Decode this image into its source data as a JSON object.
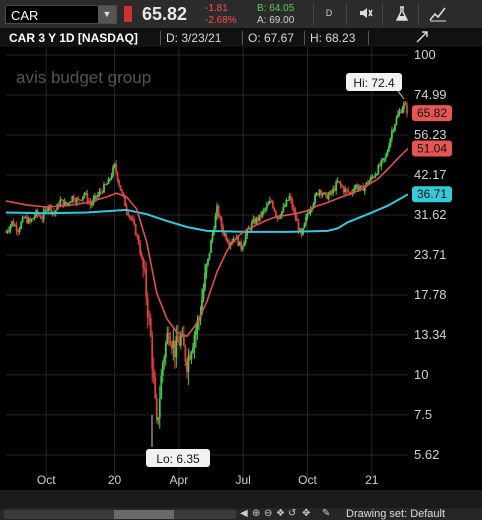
{
  "toolbar": {
    "symbol": "CAR",
    "last": "65.82",
    "change": "-1.81",
    "change_pct": "-2.68%",
    "bid": "B: 64.05",
    "ask": "A: 69.00",
    "d_label": "D",
    "icons": [
      "dropdown-icon",
      "flag-icon",
      "speaker-icon",
      "flask-icon",
      "draw-icon"
    ]
  },
  "header": {
    "title": "CAR 3 Y 1D [NASDAQ]",
    "date": "D: 3/23/21",
    "open": "O: 67.67",
    "high": "H: 68.23",
    "icon": "expand-icon"
  },
  "chart_data": {
    "type": "candlestick",
    "watermark": "avis budget group",
    "y_scale": "log",
    "y_ticks": [
      "100",
      "74.99",
      "56.23",
      "42.17",
      "31.62",
      "23.71",
      "17.78",
      "13.34",
      "10",
      "7.5",
      "5.62"
    ],
    "x_ticks": [
      "Oct",
      "20",
      "Apr",
      "Jul",
      "Oct",
      "21"
    ],
    "price_labels": [
      {
        "text": "65.82",
        "value": 65.82,
        "color": "#e85555"
      },
      {
        "text": "51.04",
        "value": 51.04,
        "color": "#e85555"
      },
      {
        "text": "36.71",
        "value": 36.71,
        "color": "#36c9d9"
      }
    ],
    "hi_label": "Hi: 72.4",
    "lo_label": "Lo: 6.35",
    "price_series": [
      [
        0,
        28
      ],
      [
        3,
        30
      ],
      [
        6,
        28.5
      ],
      [
        9,
        31
      ],
      [
        12,
        30
      ],
      [
        15,
        32
      ],
      [
        18,
        31
      ],
      [
        21,
        34
      ],
      [
        24,
        32
      ],
      [
        27,
        35
      ],
      [
        30,
        34
      ],
      [
        33,
        36
      ],
      [
        36,
        35
      ],
      [
        39,
        37
      ],
      [
        42,
        34
      ],
      [
        45,
        36
      ],
      [
        48,
        38
      ],
      [
        51,
        40
      ],
      [
        54,
        45
      ],
      [
        57,
        38
      ],
      [
        60,
        33
      ],
      [
        63,
        30
      ],
      [
        66,
        26
      ],
      [
        69,
        20
      ],
      [
        72,
        13
      ],
      [
        75,
        6.8
      ],
      [
        78,
        11
      ],
      [
        81,
        14
      ],
      [
        84,
        12
      ],
      [
        87,
        13
      ],
      [
        90,
        11
      ],
      [
        93,
        13
      ],
      [
        96,
        15
      ],
      [
        99,
        20
      ],
      [
        102,
        26
      ],
      [
        105,
        33
      ],
      [
        108,
        28
      ],
      [
        111,
        26
      ],
      [
        114,
        27
      ],
      [
        117,
        25
      ],
      [
        120,
        28
      ],
      [
        123,
        30
      ],
      [
        126,
        31
      ],
      [
        129,
        33
      ],
      [
        132,
        35
      ],
      [
        135,
        31
      ],
      [
        138,
        33
      ],
      [
        141,
        36
      ],
      [
        144,
        31
      ],
      [
        147,
        27
      ],
      [
        150,
        32
      ],
      [
        153,
        35
      ],
      [
        156,
        38
      ],
      [
        159,
        36
      ],
      [
        162,
        37
      ],
      [
        165,
        40
      ],
      [
        168,
        38
      ],
      [
        171,
        37
      ],
      [
        174,
        39
      ],
      [
        177,
        38
      ],
      [
        180,
        40
      ],
      [
        183,
        42
      ],
      [
        186,
        45
      ],
      [
        189,
        48
      ],
      [
        192,
        58
      ],
      [
        195,
        65
      ],
      [
        198,
        70
      ],
      [
        200,
        65.82
      ]
    ],
    "ma_red": [
      [
        0,
        35
      ],
      [
        10,
        34
      ],
      [
        20,
        33.5
      ],
      [
        30,
        33.8
      ],
      [
        40,
        34.5
      ],
      [
        50,
        36
      ],
      [
        55,
        37
      ],
      [
        60,
        36
      ],
      [
        65,
        33
      ],
      [
        70,
        26
      ],
      [
        75,
        18
      ],
      [
        80,
        15
      ],
      [
        85,
        13.6
      ],
      [
        90,
        13.2
      ],
      [
        95,
        14.5
      ],
      [
        100,
        17
      ],
      [
        105,
        21
      ],
      [
        110,
        24.5
      ],
      [
        115,
        27
      ],
      [
        120,
        28.5
      ],
      [
        125,
        29.5
      ],
      [
        130,
        30.5
      ],
      [
        135,
        31.3
      ],
      [
        140,
        31.6
      ],
      [
        145,
        32
      ],
      [
        150,
        32.6
      ],
      [
        155,
        33.8
      ],
      [
        160,
        34.6
      ],
      [
        165,
        35.6
      ],
      [
        170,
        36.6
      ],
      [
        175,
        37.6
      ],
      [
        180,
        39.2
      ],
      [
        185,
        41
      ],
      [
        190,
        44
      ],
      [
        195,
        47.5
      ],
      [
        200,
        51.04
      ]
    ],
    "ma_cyan": [
      [
        0,
        32.2
      ],
      [
        20,
        32
      ],
      [
        40,
        32.2
      ],
      [
        60,
        32.8
      ],
      [
        70,
        31.8
      ],
      [
        80,
        30.3
      ],
      [
        90,
        29
      ],
      [
        100,
        28.2
      ],
      [
        120,
        28
      ],
      [
        140,
        28
      ],
      [
        150,
        28.1
      ],
      [
        160,
        28.2
      ],
      [
        165,
        28.7
      ],
      [
        170,
        30
      ],
      [
        180,
        31.8
      ],
      [
        190,
        33.8
      ],
      [
        200,
        36.71
      ]
    ],
    "time_axis": {
      "start": 0,
      "end": 200
    }
  },
  "bottom": {
    "drawing_set": "Drawing set: Default",
    "icons": [
      "scroll-left-icon",
      "zoom-in-icon",
      "zoom-out-icon",
      "refresh-icon",
      "nav-icon",
      "pencil-icon"
    ]
  }
}
